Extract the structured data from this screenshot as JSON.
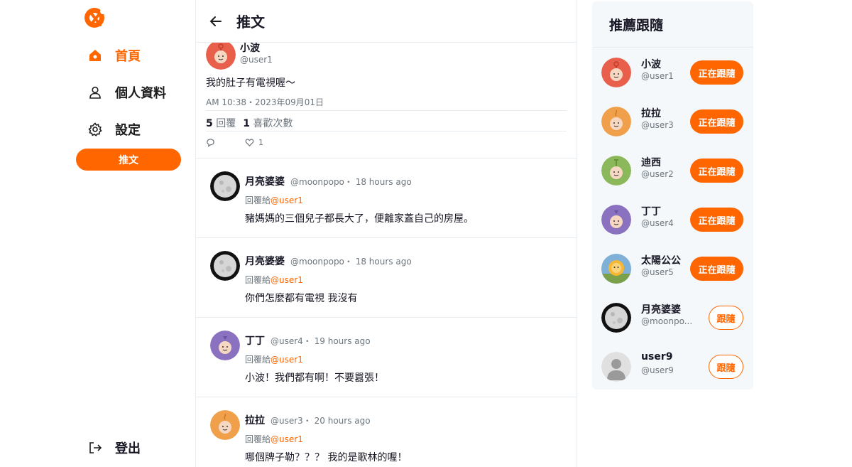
{
  "nav": {
    "items": [
      {
        "label": "首頁",
        "icon": "home-icon",
        "active": true
      },
      {
        "label": "個人資料",
        "icon": "user-icon",
        "active": false
      },
      {
        "label": "設定",
        "icon": "gear-icon",
        "active": false
      }
    ],
    "tweet_button": "推文",
    "logout": "登出"
  },
  "main": {
    "title": "推文",
    "tweet": {
      "name": "小波",
      "handle": "@user1",
      "text": "我的肚子有電視喔～",
      "time": "AM 10:38・2023年09月01日",
      "replies_count": "5",
      "replies_label": "回覆",
      "likes_count": "1",
      "likes_label": "喜歡次數",
      "like_action_count": "1"
    },
    "replies": [
      {
        "name": "月亮婆婆",
        "meta": "@moonpopo・ 18 hours ago",
        "to_label": "回覆給",
        "to": "@user1",
        "text": "豬媽媽的三個兒子都長大了，便離家蓋自己的房屋。",
        "avatar": "moon"
      },
      {
        "name": "月亮婆婆",
        "meta": "@moonpopo・ 18 hours ago",
        "to_label": "回覆給",
        "to": "@user1",
        "text": "你們怎麼都有電視 我沒有",
        "avatar": "moon"
      },
      {
        "name": "丁丁",
        "meta": "@user4・ 19 hours ago",
        "to_label": "回覆給",
        "to": "@user1",
        "text": "小波！我們都有啊！不要囂張！",
        "avatar": "purple"
      },
      {
        "name": "拉拉",
        "meta": "@user3・ 20 hours ago",
        "to_label": "回覆給",
        "to": "@user1",
        "text": "哪個牌子勒？？？ 我的是歌林的喔！",
        "avatar": "yellow"
      }
    ]
  },
  "suggest": {
    "title": "推薦跟隨",
    "users": [
      {
        "name": "小波",
        "handle": "@user1",
        "button": "正在跟隨",
        "following": true,
        "avatar": "red"
      },
      {
        "name": "拉拉",
        "handle": "@user3",
        "button": "正在跟隨",
        "following": true,
        "avatar": "yellow"
      },
      {
        "name": "迪西",
        "handle": "@user2",
        "button": "正在跟隨",
        "following": true,
        "avatar": "green"
      },
      {
        "name": "丁丁",
        "handle": "@user4",
        "button": "正在跟隨",
        "following": true,
        "avatar": "purple"
      },
      {
        "name": "太陽公公",
        "handle": "@user5",
        "button": "正在跟隨",
        "following": true,
        "avatar": "sun"
      },
      {
        "name": "月亮婆婆",
        "handle": "@moonpo...",
        "button": "跟隨",
        "following": false,
        "avatar": "moon"
      },
      {
        "name": "user9",
        "handle": "@user9",
        "button": "跟隨",
        "following": false,
        "avatar": "default"
      }
    ]
  },
  "colors": {
    "accent": "#ff6600",
    "avatar_red": "#e8604c",
    "avatar_yellow": "#f0a04a",
    "avatar_green": "#8bb85a",
    "avatar_purple": "#8a72c0",
    "avatar_default": "#b8b8b8"
  }
}
